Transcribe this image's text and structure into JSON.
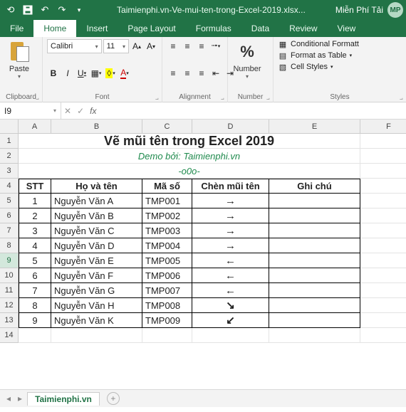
{
  "titlebar": {
    "title": "Taimienphi.vn-Ve-mui-ten-trong-Excel-2019.xlsx...",
    "user_label": "Miễn Phí Tải",
    "user_initials": "MP"
  },
  "tabs": [
    "File",
    "Home",
    "Insert",
    "Page Layout",
    "Formulas",
    "Data",
    "Review",
    "View"
  ],
  "active_tab": "Home",
  "ribbon": {
    "clipboard": {
      "paste": "Paste",
      "label": "Clipboard"
    },
    "font": {
      "name": "Calibri",
      "size": "11",
      "label": "Font"
    },
    "alignment": {
      "label": "Alignment"
    },
    "number": {
      "label": "Number",
      "big": "%"
    },
    "styles": {
      "label": "Styles",
      "cond": "Conditional Formatt",
      "table": "Format as Table",
      "cell": "Cell Styles"
    }
  },
  "name_box": "I9",
  "columns": [
    "A",
    "B",
    "C",
    "D",
    "E",
    "F"
  ],
  "col_widths": [
    "wA",
    "wB",
    "wC",
    "wD",
    "wE",
    "wF"
  ],
  "row_numbers": [
    "1",
    "2",
    "3",
    "4",
    "5",
    "6",
    "7",
    "8",
    "9",
    "10",
    "11",
    "12",
    "13",
    "14"
  ],
  "title_row": "Vẽ mũi tên trong Excel 2019",
  "demo_row": "Demo bởi: Taimienphi.vn",
  "sep_row": "-o0o-",
  "headers": [
    "STT",
    "Họ và tên",
    "Mã số",
    "Chèn mũi tên",
    "Ghi chú"
  ],
  "data": [
    {
      "stt": "1",
      "name": "Nguyễn Văn A",
      "code": "TMP001",
      "arrow": "right"
    },
    {
      "stt": "2",
      "name": "Nguyễn Văn B",
      "code": "TMP002",
      "arrow": "right"
    },
    {
      "stt": "3",
      "name": "Nguyễn Văn C",
      "code": "TMP003",
      "arrow": "right"
    },
    {
      "stt": "4",
      "name": "Nguyễn Văn D",
      "code": "TMP004",
      "arrow": "right"
    },
    {
      "stt": "5",
      "name": "Nguyễn Văn E",
      "code": "TMP005",
      "arrow": "left"
    },
    {
      "stt": "6",
      "name": "Nguyễn Văn F",
      "code": "TMP006",
      "arrow": "left"
    },
    {
      "stt": "7",
      "name": "Nguyễn Văn G",
      "code": "TMP007",
      "arrow": "left"
    },
    {
      "stt": "8",
      "name": "Nguyễn Văn H",
      "code": "TMP008",
      "arrow": "downright"
    },
    {
      "stt": "9",
      "name": "Nguyễn Văn K",
      "code": "TMP009",
      "arrow": "downleft"
    }
  ],
  "arrow_glyphs": {
    "right": "→",
    "left": "←",
    "downright": "↘",
    "downleft": "↙"
  },
  "sheet_tab": "Taimienphi.vn",
  "active_row": 9
}
